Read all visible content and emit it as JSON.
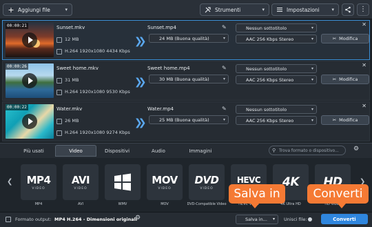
{
  "toolbar": {
    "add_files": "Aggiungi file",
    "tools": "Strumenti",
    "settings": "Impostazioni"
  },
  "files": [
    {
      "duration": "00:00:21",
      "name": "Sunset.mkv",
      "size": "12 MB",
      "info": "H.264 1920x1080 4434 Kbps",
      "output_name": "Sunset.mp4",
      "output_size": "24 MB (Buona qualità)",
      "subtitle": "Nessun sottotitolo",
      "audio": "AAC 256 Kbps Stereo",
      "edit": "Modifica"
    },
    {
      "duration": "00:00:26",
      "name": "Sweet home.mkv",
      "size": "31 MB",
      "info": "H.264 1920x1080 9530 Kbps",
      "output_name": "Sweet home.mp4",
      "output_size": "30 MB (Buona qualità)",
      "subtitle": "Nessun sottotitolo",
      "audio": "AAC 256 Kbps Stereo",
      "edit": "Modifica"
    },
    {
      "duration": "00:00:22",
      "name": "Water.mkv",
      "size": "26 MB",
      "info": "H.264 1920x1080 9274 Kbps",
      "output_name": "Water.mp4",
      "output_size": "25 MB (Buona qualità)",
      "subtitle": "Nessun sottotitolo",
      "audio": "AAC 256 Kbps Stereo",
      "edit": "Modifica"
    }
  ],
  "tabs": [
    "Più usati",
    "Video",
    "Dispositivi",
    "Audio",
    "Immagini"
  ],
  "active_tab": "Video",
  "search_placeholder": "Trova formato o dispositivo...",
  "formats": [
    {
      "big": "MP4",
      "small": "VIDEO",
      "label": "MP4"
    },
    {
      "big": "AVI",
      "small": "VIDEO",
      "label": "AVI"
    },
    {
      "big": "",
      "small": "",
      "label": "WMV"
    },
    {
      "big": "MOV",
      "small": "VIDEO",
      "label": "MOV"
    },
    {
      "big": "DVD",
      "small": "VIDEO",
      "label": "DVD-Compatible Video"
    },
    {
      "big": "HEVC",
      "small": "H.265",
      "label": "HEVC Video"
    },
    {
      "big": "4K",
      "small": "",
      "label": "4K Ultra HD"
    },
    {
      "big": "HD",
      "small": "",
      "label": "HD Video"
    }
  ],
  "status": {
    "output_format_label": "Formato output:",
    "output_format_value": "MP4 H.264 - Dimensioni originali",
    "save_in": "Salva in...",
    "merge_files": "Unisci file:",
    "convert": "Converti"
  },
  "callouts": {
    "save_in": "Salva in",
    "convert": "Converti"
  },
  "colors": {
    "accent": "#3b8fd6",
    "callout": "#f57a34",
    "convert_button": "#2f86de"
  }
}
